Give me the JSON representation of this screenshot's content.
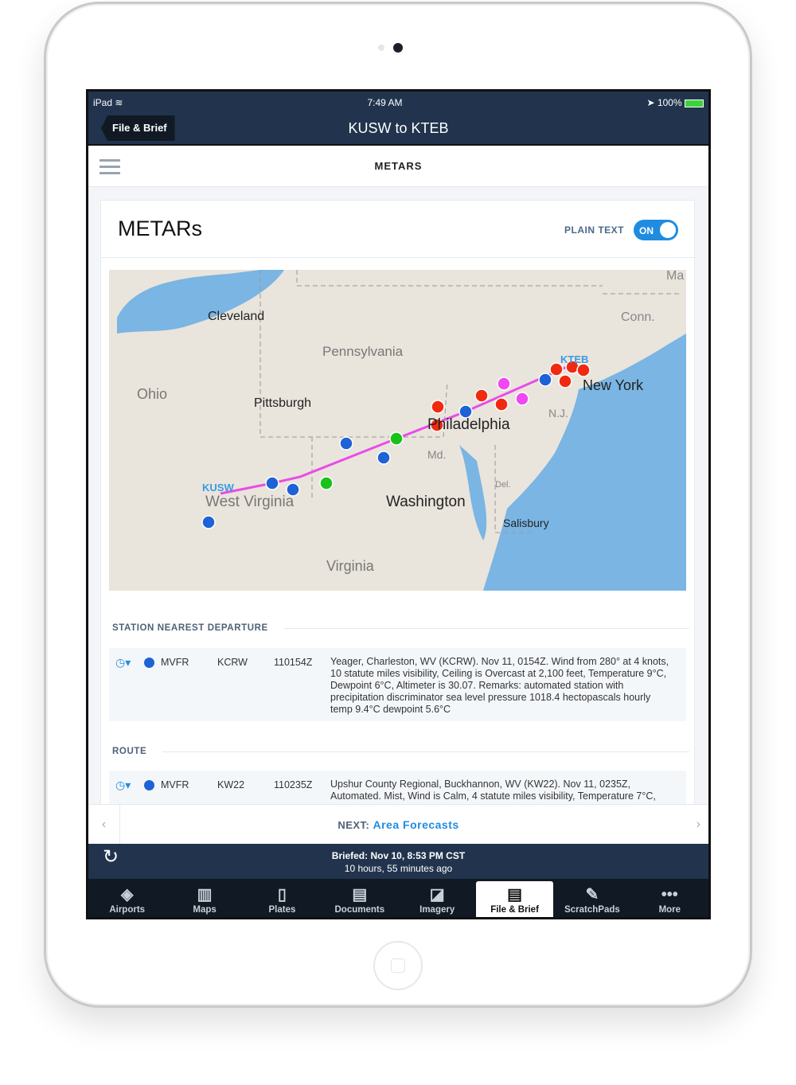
{
  "status": {
    "device": "iPad",
    "time": "7:49 AM",
    "battery": "100%"
  },
  "nav": {
    "back": "File & Brief",
    "title": "KUSW to KTEB"
  },
  "subheader": {
    "title": "METARS"
  },
  "card": {
    "title": "METARs",
    "plain_text_label": "PLAIN TEXT",
    "toggle": "ON"
  },
  "map": {
    "labels": {
      "cleveland": "Cleveland",
      "pennsylvania": "Pennsylvania",
      "ohio": "Ohio",
      "pittsburgh": "Pittsburgh",
      "conn": "Conn.",
      "ma": "Ma",
      "new_york": "New York",
      "nj": "N.J.",
      "philadelphia": "Philadelphia",
      "md": "Md.",
      "del": "Del.",
      "washington": "Washington",
      "salisbury": "Salisbury",
      "west_virginia": "West Virginia",
      "virginia": "Virginia",
      "kusw": "KUSW",
      "kteb": "KTEB"
    },
    "category_colors": {
      "VFR": "#19c21b",
      "MVFR": "#1e62d6",
      "IFR": "#f02a10",
      "LIFR": "#f048f0"
    },
    "route_color": "#e84de8",
    "markers": [
      "MVFR",
      "IFR",
      "IFR",
      "IFR",
      "IFR",
      "LIFR",
      "LIFR",
      "IFR",
      "IFR",
      "IFR",
      "IFR",
      "MVFR",
      "VFR",
      "MVFR",
      "MVFR",
      "VFR",
      "MVFR",
      "MVFR",
      "MVFR"
    ]
  },
  "sections": {
    "departure": {
      "title": "STATION NEAREST DEPARTURE",
      "rows": [
        {
          "category": "MVFR",
          "station": "KCRW",
          "time": "110154Z",
          "text": "Yeager, Charleston, WV (KCRW). Nov 11, 0154Z. Wind from 280° at 4 knots, 10 statute miles visibility, Ceiling is Overcast at 2,100 feet, Temperature 9°C, Dewpoint 6°C, Altimeter is 30.07. Remarks: automated station with precipitation discriminator sea level pressure 1018.4 hectopascals hourly temp 9.4°C dewpoint 5.6°C"
        }
      ]
    },
    "route": {
      "title": "ROUTE",
      "rows": [
        {
          "category": "MVFR",
          "station": "KW22",
          "time": "110235Z",
          "text": "Upshur County Regional, Buckhannon, WV (KW22). Nov 11, 0235Z, Automated. Mist, Wind is Calm, 4 statute miles visibility, Temperature 7°C,"
        }
      ]
    }
  },
  "next": {
    "prefix": "NEXT:",
    "label": "Area Forecasts"
  },
  "brief": {
    "line1": "Briefed: Nov 10, 8:53 PM CST",
    "line2": "10 hours, 55 minutes ago"
  },
  "tabs": [
    {
      "label": "Airports"
    },
    {
      "label": "Maps"
    },
    {
      "label": "Plates"
    },
    {
      "label": "Documents"
    },
    {
      "label": "Imagery"
    },
    {
      "label": "File & Brief",
      "active": true
    },
    {
      "label": "ScratchPads"
    },
    {
      "label": "More"
    }
  ]
}
